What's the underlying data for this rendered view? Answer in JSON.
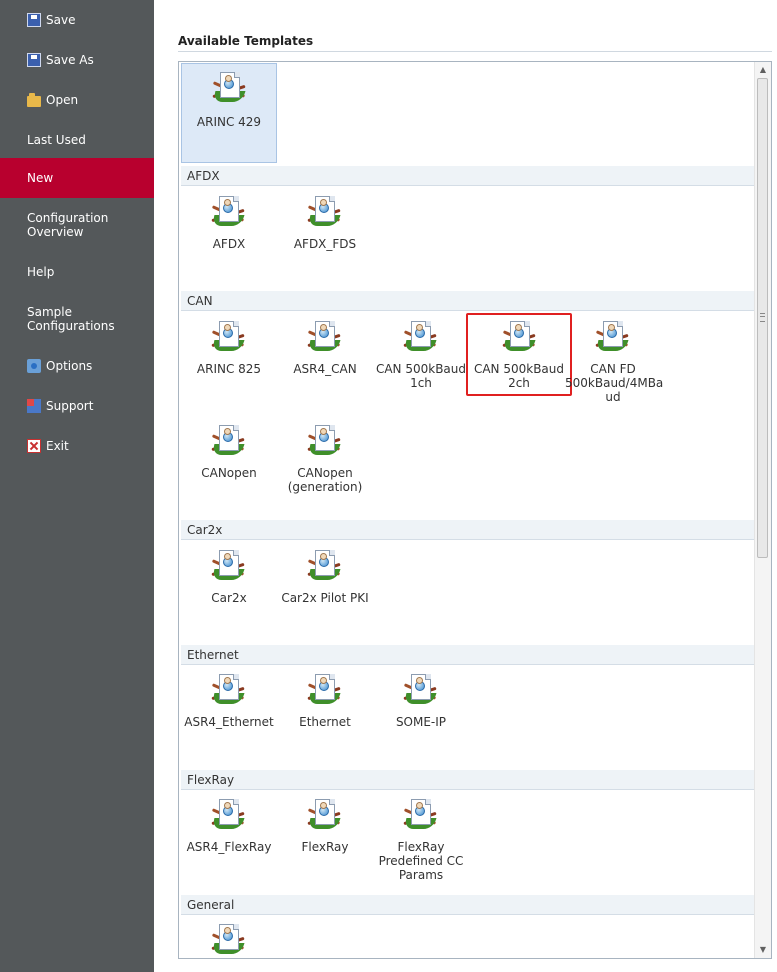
{
  "sidebar": {
    "items": [
      {
        "label": "Save",
        "icon": "save-icon"
      },
      {
        "label": "Save As",
        "icon": "save-as-icon"
      },
      {
        "label": "Open",
        "icon": "open-folder-icon"
      },
      {
        "label": "Last Used"
      },
      {
        "label": "New",
        "active": true
      },
      {
        "label": "Configuration\nOverview"
      },
      {
        "label": "Help"
      },
      {
        "label": "Sample\nConfigurations"
      },
      {
        "label": "Options",
        "icon": "options-icon"
      },
      {
        "label": "Support",
        "icon": "support-icon"
      },
      {
        "label": "Exit",
        "icon": "exit-icon"
      }
    ],
    "active_color": "#b8002e",
    "background_color": "#54585a"
  },
  "main": {
    "title": "Available Templates",
    "top_tile": {
      "label": "ARINC 429",
      "icon": "template-icon"
    },
    "groups": [
      {
        "name": "AFDX",
        "tiles": [
          {
            "label": "AFDX"
          },
          {
            "label": "AFDX_FDS"
          }
        ]
      },
      {
        "name": "CAN",
        "tiles": [
          {
            "label": "ARINC 825"
          },
          {
            "label": "ASR4_CAN"
          },
          {
            "label": "CAN 500kBaud\n1ch"
          },
          {
            "label": "CAN 500kBaud\n2ch",
            "highlighted": true
          },
          {
            "label": "CAN FD\n500kBaud/4MBa\nud"
          },
          {
            "label": "CANopen"
          },
          {
            "label": "CANopen\n(generation)"
          }
        ]
      },
      {
        "name": "Car2x",
        "tiles": [
          {
            "label": "Car2x"
          },
          {
            "label": "Car2x Pilot PKI"
          }
        ]
      },
      {
        "name": "Ethernet",
        "tiles": [
          {
            "label": "ASR4_Ethernet"
          },
          {
            "label": "Ethernet"
          },
          {
            "label": "SOME-IP"
          }
        ]
      },
      {
        "name": "FlexRay",
        "tiles": [
          {
            "label": "ASR4_FlexRay"
          },
          {
            "label": "FlexRay"
          },
          {
            "label": "FlexRay\nPredefined CC\nParams"
          }
        ]
      },
      {
        "name": "General",
        "tiles": [
          {
            "label": ""
          }
        ]
      }
    ],
    "highlight_color": "#e02020"
  }
}
